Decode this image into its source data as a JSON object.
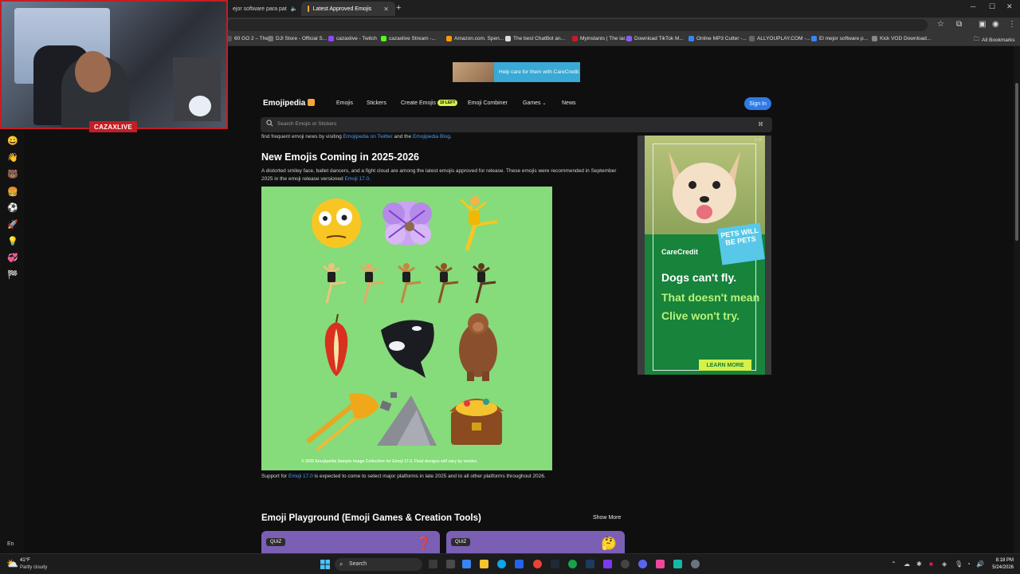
{
  "browser": {
    "tabs": [
      {
        "title": "ejor software para pat"
      },
      {
        "title": "Latest Approved Emojis"
      }
    ],
    "bookmarks": [
      {
        "label": "60 GO 2 – The..",
        "color": "#555"
      },
      {
        "label": "DJI Store - Official S...",
        "color": "#777"
      },
      {
        "label": "cazaxlive - Twitch",
        "color": "#9146ff"
      },
      {
        "label": "cazaxlive Stream -...",
        "color": "#53fc18"
      },
      {
        "label": "Amazon.com. Spen...",
        "color": "#ff9900"
      },
      {
        "label": "The best ChatBot an...",
        "color": "#ddd"
      },
      {
        "label": "Myinstants | The lar...",
        "color": "#c51d24"
      },
      {
        "label": "Download TikTok M...",
        "color": "#8a5cf6"
      },
      {
        "label": "Online MP3 Cutter -...",
        "color": "#3b82f6"
      },
      {
        "label": "ALLYOUPLAY.COM -...",
        "color": "#666"
      },
      {
        "label": "El mejor software p...",
        "color": "#3b82f6"
      },
      {
        "label": "Kick VOD Download...",
        "color": "#888"
      }
    ],
    "all_bookmarks": "All Bookmarks"
  },
  "webcam": {
    "streamer_name": "CAZAXLIVE"
  },
  "site": {
    "logo": "Emojipedia",
    "nav": {
      "emojis": "Emojis",
      "stickers": "Stickers",
      "create": "Create Emojis",
      "create_badge": "10 LEFT",
      "combiner": "Emoji Combiner",
      "games": "Games",
      "news": "News"
    },
    "sign_in": "Sign In",
    "search_placeholder": "Search Emojis or Stickers"
  },
  "top_ad": {
    "text": "Help care for them with CareCredit."
  },
  "article": {
    "intro_prefix": "find frequent emoji news by visiting",
    "intro_link1": "Emojipedia on Twitter",
    "intro_mid": "and the",
    "intro_link2": "Emojipedia Blog",
    "intro_suffix": ".",
    "heading": "New Emojis Coming in 2025-2026",
    "desc_prefix": "A distorted smiley face, ballet dancers, and a fight cloud are among the latest emojis approved for release. These emojis were recommended in September 2025 in the emoji release versioned",
    "desc_link": "Emoji 17.0",
    "desc_suffix": ".",
    "preview_caption": "© 2025 Emojipedia Sample Image Collection for Emoji 17.0. Final designs will vary by vendor.",
    "support_prefix": "Support for",
    "support_link": "Emoji 17.0",
    "support_suffix": "is expected to come to select major platforms in late 2025 and to all other platforms throughout 2026.",
    "playground_heading": "Emoji Playground (Emoji Games & Creation Tools)",
    "show_more": "Show More",
    "cards": [
      {
        "badge": "QUIZ"
      },
      {
        "badge": "QUIZ"
      }
    ]
  },
  "side_ad": {
    "brand": "CareCredit",
    "line1": "Dogs can't fly.",
    "line2": "That doesn't mean Clive won't try.",
    "badge": "PETS WILL BE PETS",
    "cta": "LEARN MORE"
  },
  "taskbar": {
    "temp": "41°F",
    "weather": "Partly cloudy",
    "search": "Search",
    "time": "8:18 PM",
    "date": "5/24/2026",
    "lang": "En"
  }
}
